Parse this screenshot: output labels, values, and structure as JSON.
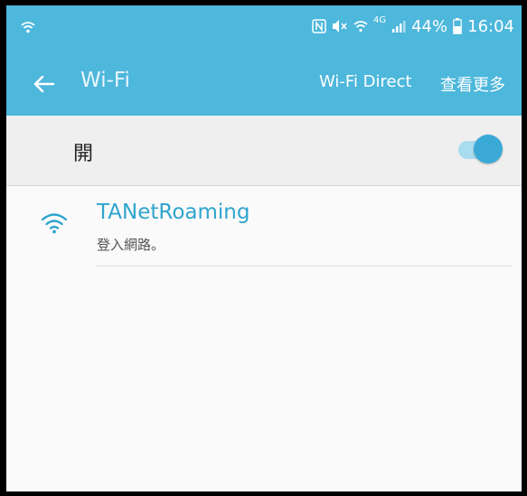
{
  "status_bar": {
    "battery_percent": "44%",
    "time": "16:04",
    "network_type": "4G"
  },
  "app_bar": {
    "title": "Wi-Fi",
    "action_wifi_direct": "Wi-Fi Direct",
    "action_more": "查看更多"
  },
  "wifi_toggle": {
    "label": "開",
    "state": "on"
  },
  "networks": [
    {
      "name": "TANetRoaming",
      "status": "登入網路。"
    }
  ],
  "colors": {
    "header": "#4db7dc",
    "accent": "#2fa4cf",
    "switch_thumb": "#3aa9d6"
  }
}
